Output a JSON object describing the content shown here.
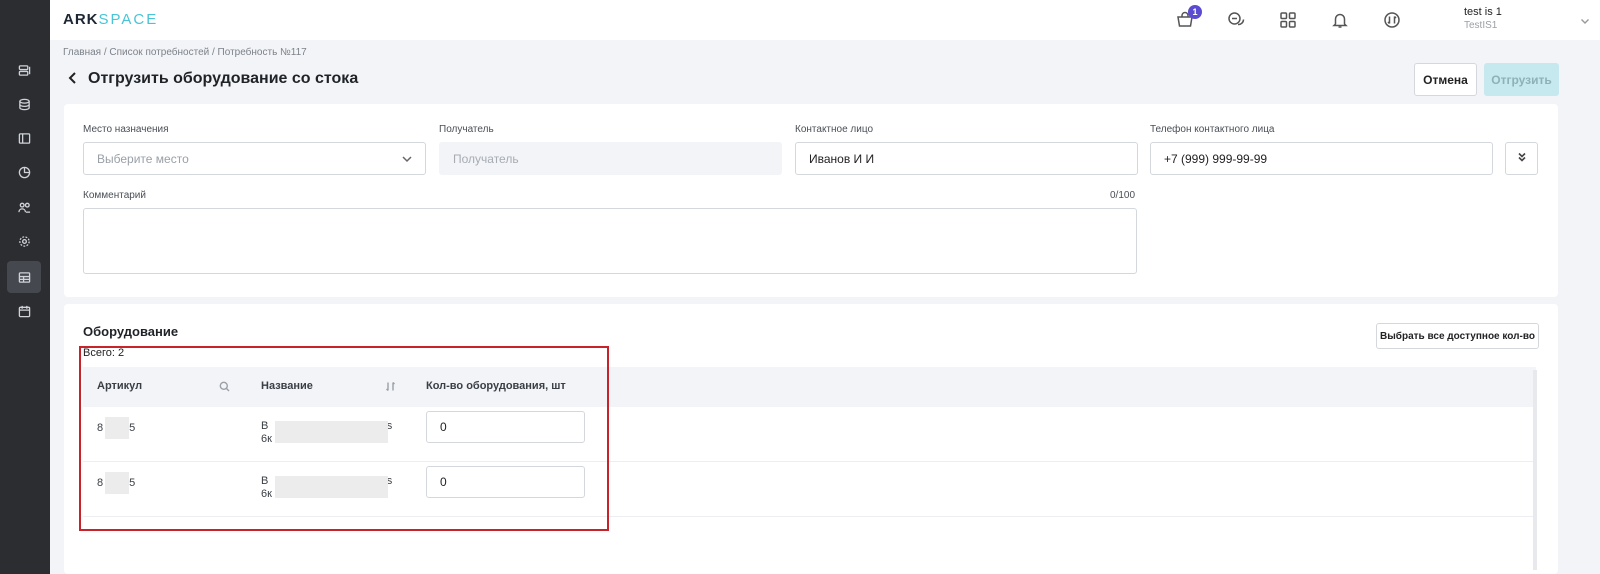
{
  "header": {
    "logo_ark": "ARK",
    "logo_space": "SPACE",
    "cart_badge": "1",
    "user_name": "test is 1",
    "user_sub": "TestIS1"
  },
  "breadcrumb": "Главная / Список потребностей / Потребность №117",
  "page": {
    "title": "Отгрузить оборудование со стока",
    "cancel_label": "Отмена",
    "ship_label": "Отгрузить"
  },
  "form": {
    "destination_label": "Место назначения",
    "destination_placeholder": "Выберите место",
    "recipient_label": "Получатель",
    "recipient_placeholder": "Получатель",
    "contact_label": "Контактное лицо",
    "contact_value": "Иванов И И",
    "phone_label": "Телефон контактного лица",
    "phone_value": "+7 (999) 999-99-99",
    "comment_label": "Комментарий",
    "comment_counter": "0/100"
  },
  "equipment": {
    "title": "Оборудование",
    "total": "Всего: 2",
    "select_all_label": "Выбрать все доступное кол-во",
    "columns": {
      "article": "Артикул",
      "name": "Название",
      "qty": "Кол-во оборудования, шт"
    },
    "rows": [
      {
        "article_a": "8",
        "article_b": "5",
        "name_a": "В",
        "name_b": "is",
        "name_c": "6к",
        "qty": "0"
      },
      {
        "article_a": "8",
        "article_b": "5",
        "name_a": "В",
        "name_b": "is",
        "name_c": "6к",
        "qty": "0"
      }
    ]
  },
  "icons": {
    "sidebar": [
      "list-icon",
      "database-icon",
      "layout-icon",
      "chart-icon",
      "users-icon",
      "settings-icon",
      "table-icon",
      "calendar-icon"
    ],
    "header": [
      "cart-icon",
      "chat-icon",
      "apps-grid-icon",
      "bell-icon",
      "exchange-icon"
    ]
  },
  "colors": {
    "accent": "#49c4d6",
    "badge": "#5b4bd1",
    "ship_disabled": "#c5e9ef",
    "highlight": "#c8222b",
    "sidebar": "#2b2d31"
  }
}
